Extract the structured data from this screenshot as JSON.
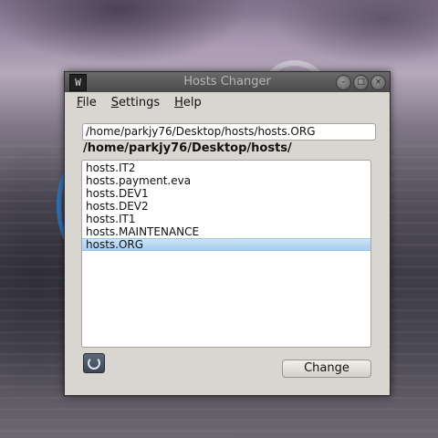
{
  "window": {
    "title": "Hosts Changer",
    "app_icon_glyph": "W",
    "controls": {
      "minimize": "–",
      "maximize": "□",
      "close": "×"
    }
  },
  "menu": {
    "items": [
      {
        "label": "File",
        "mnemonic": "F",
        "rest": "ile"
      },
      {
        "label": "Settings",
        "mnemonic": "S",
        "rest": "ettings"
      },
      {
        "label": "Help",
        "mnemonic": "H",
        "rest": "elp"
      }
    ]
  },
  "path_field": {
    "value": "/home/parkjy76/Desktop/hosts/hosts.ORG"
  },
  "directory_label": "/home/parkjy76/Desktop/hosts/",
  "hosts_list": {
    "items": [
      "hosts.IT2",
      "hosts.payment.eva",
      "hosts.DEV1",
      "hosts.DEV2",
      "hosts.IT1",
      "hosts.MAINTENANCE",
      "hosts.ORG"
    ],
    "selected": "hosts.ORG"
  },
  "buttons": {
    "refresh_icon": "refresh-icon",
    "change": "Change"
  },
  "colors": {
    "selection": "#a8cdee",
    "titlebar": "#4a4a4a",
    "window_bg": "#d9d5d1"
  }
}
